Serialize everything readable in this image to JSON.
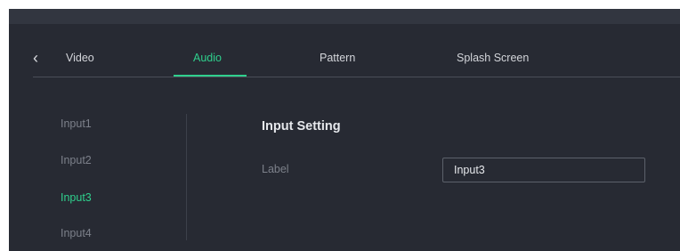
{
  "header": {
    "back_icon": "chevron-left-icon"
  },
  "tabs": [
    {
      "label": "Video",
      "active": false
    },
    {
      "label": "Audio",
      "active": true
    },
    {
      "label": "Pattern",
      "active": false
    },
    {
      "label": "Splash Screen",
      "active": false
    }
  ],
  "sidebar": {
    "items": [
      {
        "label": "Input1",
        "active": false
      },
      {
        "label": "Input2",
        "active": false
      },
      {
        "label": "Input3",
        "active": true
      },
      {
        "label": "Input4",
        "active": false
      }
    ]
  },
  "main": {
    "section_title": "Input Setting",
    "label_field": {
      "label": "Label",
      "value": "Input3"
    }
  },
  "colors": {
    "accent": "#2fd08d",
    "background": "#272a33",
    "topbar": "#323640"
  }
}
